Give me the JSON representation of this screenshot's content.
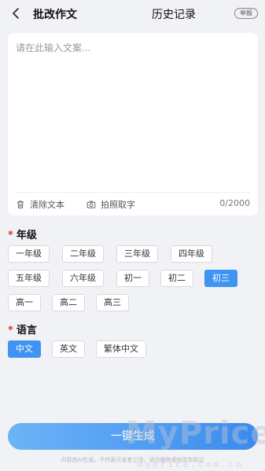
{
  "header": {
    "back_icon": "chevron-left-icon",
    "title": "批改作文",
    "history": "历史记录",
    "report": "举报"
  },
  "editor": {
    "placeholder": "请在此输入文案...",
    "value": "",
    "clear_label": "清除文本",
    "clear_icon": "trash-icon",
    "photo_label": "拍照取字",
    "photo_icon": "camera-icon",
    "char_count": "0/2000"
  },
  "grade": {
    "required_mark": "*",
    "label": "年级",
    "options": [
      "一年级",
      "二年级",
      "三年级",
      "四年级",
      "五年级",
      "六年级",
      "初一",
      "初二",
      "初三",
      "高一",
      "高二",
      "高三"
    ],
    "selected": "初三"
  },
  "language": {
    "required_mark": "*",
    "label": "语言",
    "options": [
      "中文",
      "英文",
      "繁体中文"
    ],
    "selected": "中文"
  },
  "generate_label": "一键生成",
  "footer_note": "内容由AI生成，不代表开发者立场，请勿删除或修改本标记",
  "watermark": {
    "main": "MyPrice",
    "sub": "myprice.com.cn"
  },
  "colors": {
    "accent": "#3f93f2",
    "required": "#e5322d",
    "background": "#f1f2f6"
  }
}
